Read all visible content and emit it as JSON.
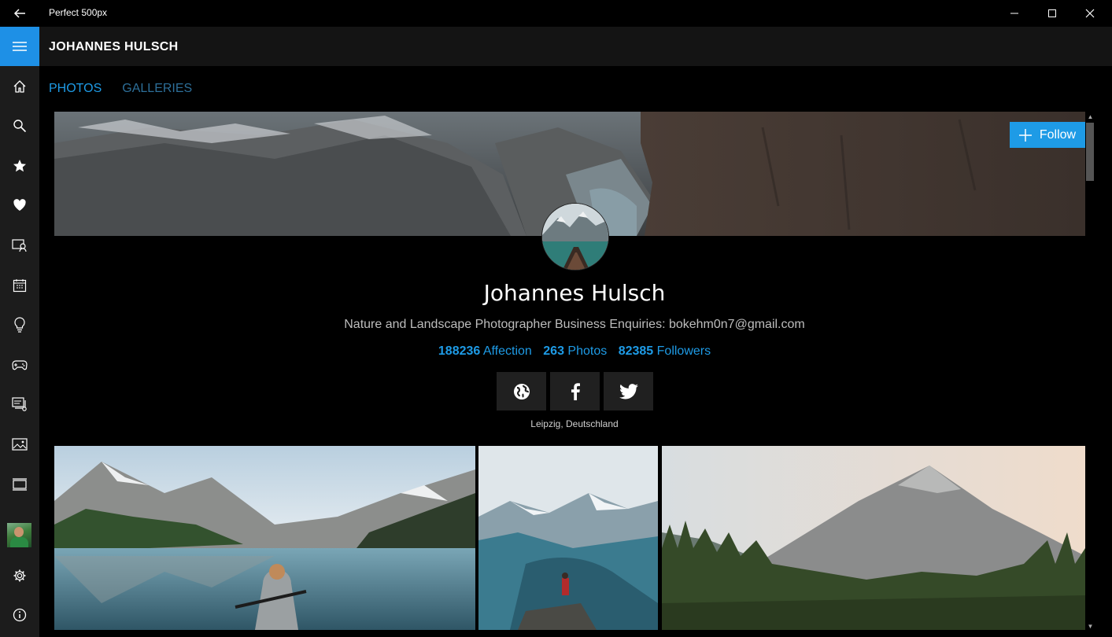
{
  "window": {
    "title": "Perfect 500px"
  },
  "header": {
    "title": "JOHANNES HULSCH"
  },
  "tabs": [
    {
      "label": "PHOTOS",
      "active": true
    },
    {
      "label": "GALLERIES",
      "active": false
    }
  ],
  "sidebar": {
    "items": [
      {
        "icon": "home-icon"
      },
      {
        "icon": "search-icon"
      },
      {
        "icon": "star-icon"
      },
      {
        "icon": "heart-icon"
      },
      {
        "icon": "user-search-icon"
      },
      {
        "icon": "calendar-icon"
      },
      {
        "icon": "lightbulb-icon"
      },
      {
        "icon": "gamepad-icon"
      },
      {
        "icon": "gallery-stack-icon"
      },
      {
        "icon": "image-icon"
      },
      {
        "icon": "slideshow-icon"
      }
    ],
    "bottom": [
      {
        "icon": "gear-icon"
      },
      {
        "icon": "info-icon"
      }
    ]
  },
  "profile": {
    "follow_label": "Follow",
    "name": "Johannes Hulsch",
    "bio": "Nature and Landscape Photographer Business Enquiries: bokehm0n7@gmail.com",
    "stats": {
      "affection_value": "188236",
      "affection_label": "Affection",
      "photos_value": "263",
      "photos_label": "Photos",
      "followers_value": "82385",
      "followers_label": "Followers"
    },
    "social": [
      {
        "icon": "globe-icon"
      },
      {
        "icon": "facebook-icon"
      },
      {
        "icon": "twitter-icon"
      }
    ],
    "location": "Leipzig, Deutschland"
  },
  "colors": {
    "accent": "#1e9be6",
    "background": "#000000",
    "sidebar": "#1c1c1c",
    "header": "#141414",
    "social_button": "#202020"
  }
}
